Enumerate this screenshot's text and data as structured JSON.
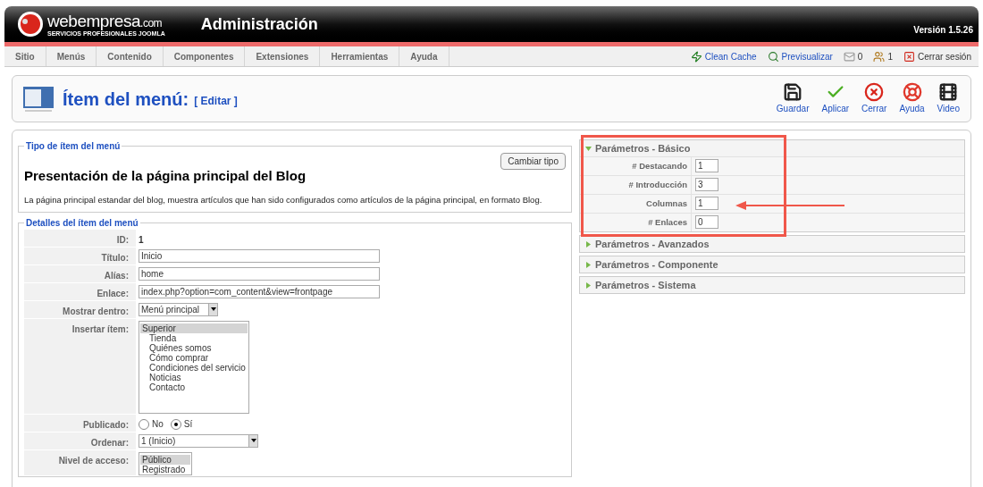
{
  "header": {
    "logo_name": "webempresa",
    "logo_domain": ".com",
    "logo_tagline": "SERVICIOS PROFESIONALES JOOMLA",
    "title": "Administración",
    "version": "Versión 1.5.26"
  },
  "menu": [
    "Sitio",
    "Menús",
    "Contenido",
    "Componentes",
    "Extensiones",
    "Herramientas",
    "Ayuda"
  ],
  "status": [
    {
      "kind": "link",
      "label": "Clean Cache"
    },
    {
      "kind": "link",
      "label": "Previsualizar"
    },
    {
      "kind": "count",
      "label": "0"
    },
    {
      "kind": "count",
      "label": "1"
    },
    {
      "kind": "plain",
      "label": "Cerrar sesión"
    }
  ],
  "page": {
    "title": "Ítem del menú:",
    "action": "[ Editar ]"
  },
  "toolbar": [
    "Guardar",
    "Aplicar",
    "Cerrar",
    "Ayuda",
    "Video"
  ],
  "type_section": {
    "legend": "Tipo de ítem del menú",
    "change_button": "Cambiar tipo",
    "heading": "Presentación de la página principal del Blog",
    "description": "La página principal estandar del blog, muestra artículos que han sido configurados como artículos de la página principal, en formato Blog."
  },
  "details": {
    "legend": "Detalles del ítem del menú",
    "rows": [
      {
        "kind": "static",
        "label": "ID:",
        "value": "1"
      },
      {
        "kind": "input",
        "label": "Título:",
        "value": "Inicio"
      },
      {
        "kind": "input",
        "label": "Alías:",
        "value": "home"
      },
      {
        "kind": "input",
        "label": "Enlace:",
        "value": "index.php?option=com_content&view=frontpage"
      },
      {
        "kind": "select",
        "label": "Mostrar dentro:",
        "value": "Menú principal"
      },
      {
        "kind": "listbox",
        "label": "Insertar ítem:",
        "options": [
          {
            "label": "Superior",
            "selected": true,
            "children": [
              {
                "label": "Tienda",
                "selected": false
              },
              {
                "label": "Quiénes somos",
                "selected": false
              },
              {
                "label": "Cómo comprar",
                "selected": false
              },
              {
                "label": "Condiciones del servicio",
                "selected": false
              },
              {
                "label": "Noticias",
                "selected": false
              },
              {
                "label": "Contacto",
                "selected": false
              }
            ]
          }
        ]
      },
      {
        "kind": "radio",
        "label": "Publicado:",
        "options": [
          {
            "label": "No",
            "selected": false
          },
          {
            "label": "Sí",
            "selected": true
          }
        ]
      },
      {
        "kind": "select",
        "label": "Ordenar:",
        "value": "1 (Inicio)"
      },
      {
        "kind": "listbox",
        "label": "Nivel de acceso:",
        "options": [
          {
            "label": "Público",
            "selected": true
          },
          {
            "label": "Registrado",
            "selected": false
          }
        ]
      }
    ]
  },
  "params": [
    {
      "title": "Parámetros - Básico",
      "expanded": true,
      "fields": [
        {
          "label": "# Destacando",
          "value": "1"
        },
        {
          "label": "# Introducción",
          "value": "3"
        },
        {
          "label": "Columnas",
          "value": "1"
        },
        {
          "label": "# Enlaces",
          "value": "0"
        }
      ]
    },
    {
      "title": "Parámetros - Avanzados",
      "expanded": false
    },
    {
      "title": "Parámetros - Componente",
      "expanded": false
    },
    {
      "title": "Parámetros - Sistema",
      "expanded": false
    }
  ]
}
